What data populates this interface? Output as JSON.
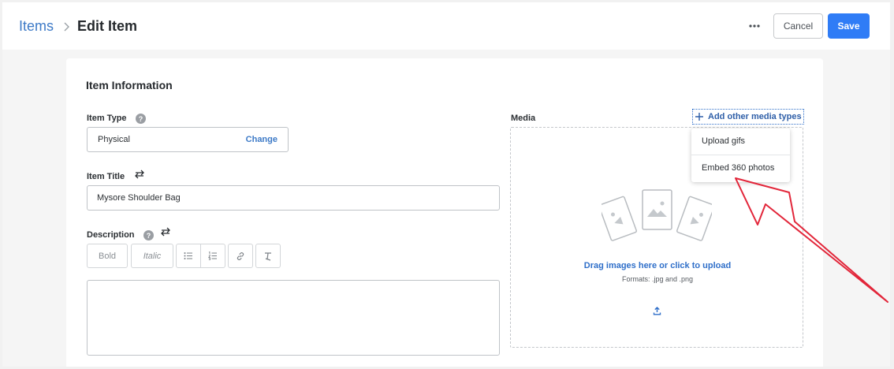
{
  "breadcrumb": {
    "parent": "Items",
    "current": "Edit Item"
  },
  "header": {
    "more_label": "•••",
    "cancel_label": "Cancel",
    "save_label": "Save"
  },
  "form": {
    "section_title": "Item Information",
    "item_type": {
      "label": "Item Type",
      "value": "Physical",
      "change_label": "Change"
    },
    "item_title": {
      "label": "Item Title",
      "value": "Mysore Shoulder Bag"
    },
    "description": {
      "label": "Description",
      "toolbar": {
        "bold": "Bold",
        "italic": "Italic"
      },
      "value": ""
    }
  },
  "media": {
    "label": "Media",
    "add_other": "Add other media types",
    "menu": [
      {
        "label": "Upload gifs"
      },
      {
        "label": "Embed 360 photos"
      }
    ],
    "drop_text": "Drag images here or click to upload",
    "formats": "Formats: .jpg and .png"
  },
  "colors": {
    "accent": "#2f7cf6",
    "link": "#3d7ac7",
    "annotation_arrow": "#e2263a"
  },
  "icons": [
    "chevron-right-icon",
    "more-icon",
    "help-icon",
    "swap-icon",
    "bullet-list-icon",
    "numbered-list-icon",
    "link-icon",
    "clear-format-icon",
    "plus-icon",
    "image-stack-icon",
    "upload-icon"
  ]
}
